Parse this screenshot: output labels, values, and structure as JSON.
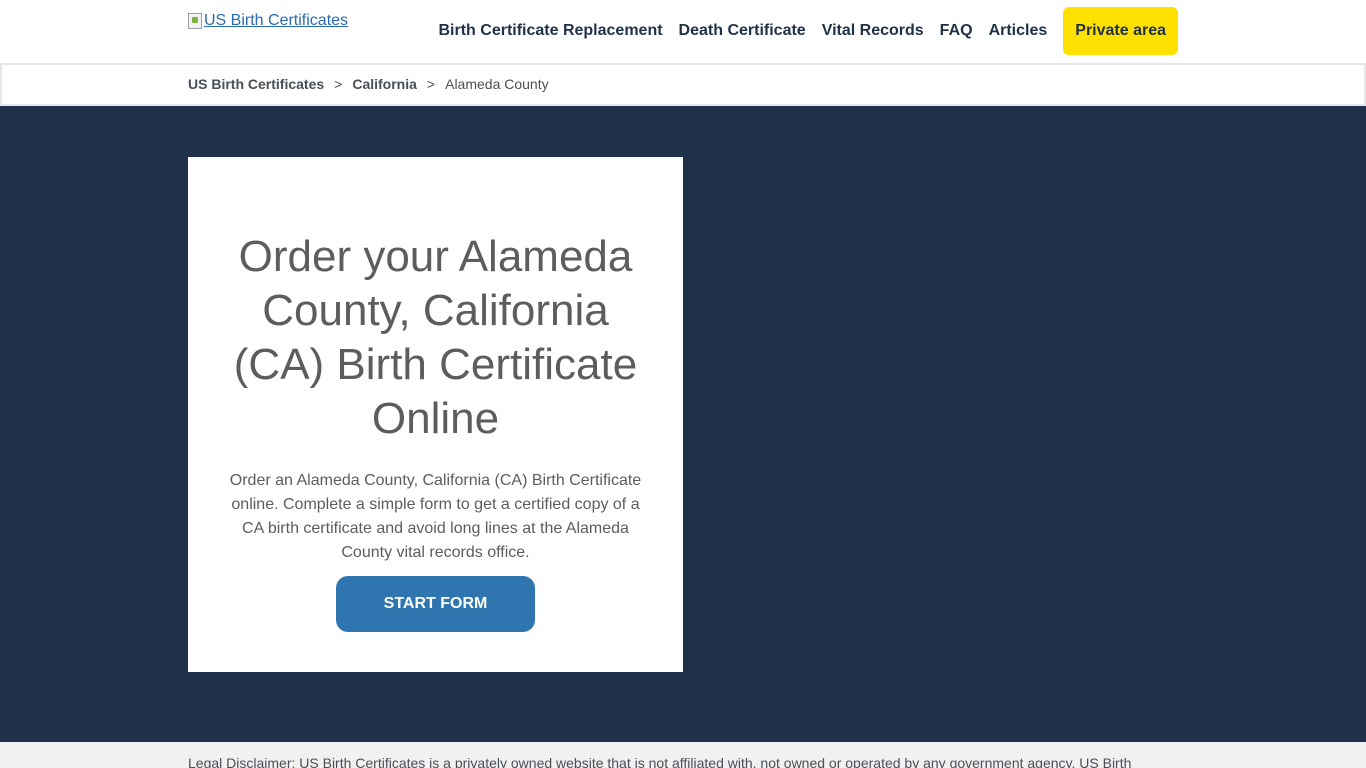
{
  "header": {
    "logo_alt": "US Birth Certificates",
    "nav": [
      {
        "label": "Birth Certificate Replacement"
      },
      {
        "label": "Death Certificate"
      },
      {
        "label": "Vital Records"
      },
      {
        "label": "FAQ"
      },
      {
        "label": "Articles"
      }
    ],
    "private_area_label": "Private area",
    "accent_color": "#ffe100"
  },
  "breadcrumb": {
    "items": [
      "US Birth Certificates",
      "California"
    ],
    "separator": ">",
    "current": "Alameda County"
  },
  "hero": {
    "background_color": "#1f304a",
    "title": "Order your Alameda County, California (CA) Birth Certificate Online",
    "description": "Order an Alameda County, California (CA) Birth Certificate online. Complete a simple form to get a certified copy of a CA birth certificate and avoid long lines at the Alameda County vital records office.",
    "cta_label": "START FORM",
    "cta_color": "#2f76b0"
  },
  "footer": {
    "disclaimer": "Legal Disclaimer: US Birth Certificates is a privately owned website that is not affiliated with, not owned or operated by any government agency. US Birth"
  }
}
